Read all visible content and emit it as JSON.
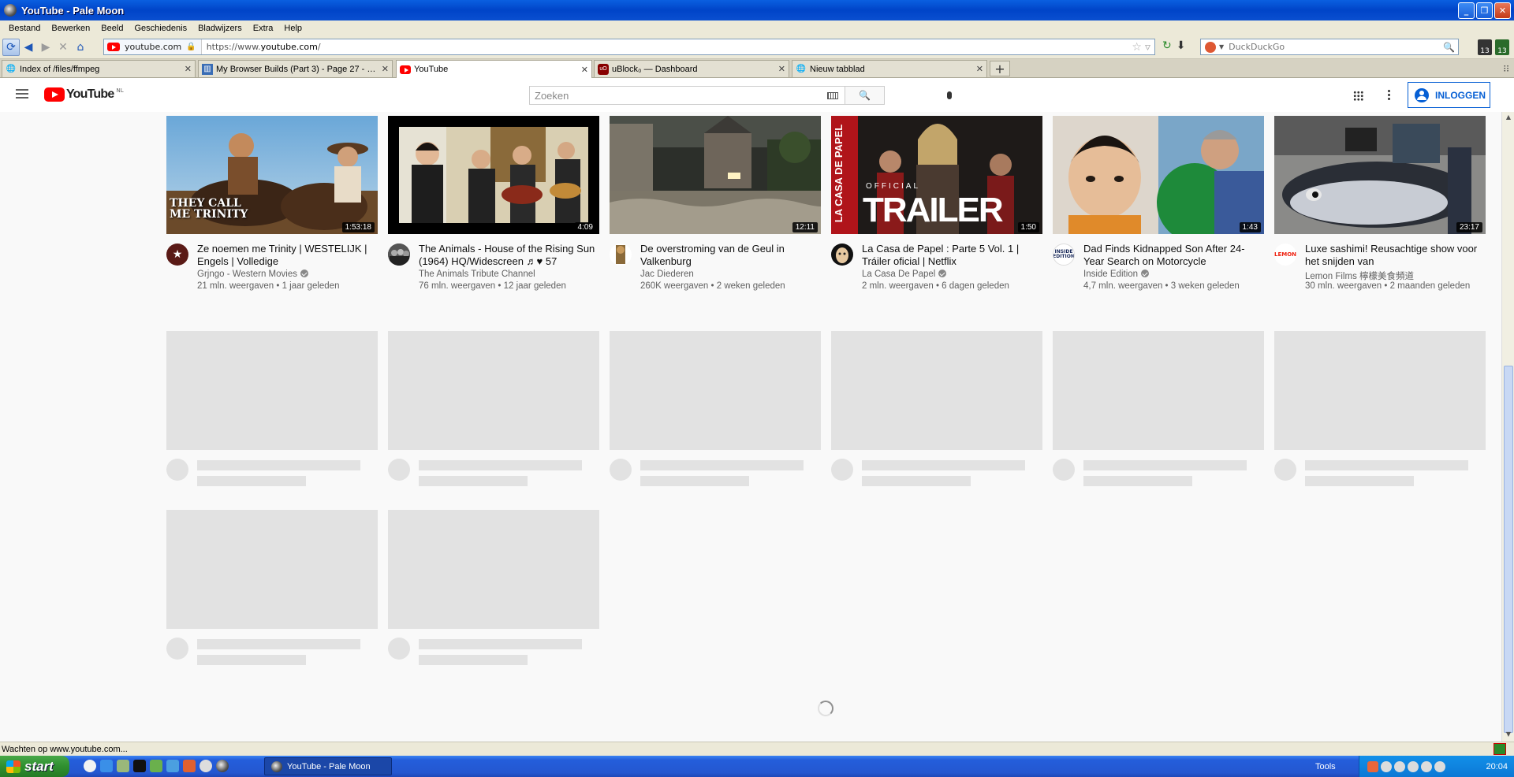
{
  "window": {
    "title": "YouTube - Pale Moon"
  },
  "menu": [
    "Bestand",
    "Bewerken",
    "Beeld",
    "Geschiedenis",
    "Bladwijzers",
    "Extra",
    "Help"
  ],
  "nav": {
    "identity": "youtube.com",
    "url_prefix": "https://www.",
    "url_host": "youtube.com",
    "url_suffix": "/",
    "search_placeholder": "DuckDuckGo",
    "ext_badge_1": "13",
    "ext_badge_2": "13"
  },
  "tabs": [
    {
      "label": "Index of /files/ffmpeg",
      "icon": "globe-icon"
    },
    {
      "label": "My Browser Builds (Part 3) - Page 27 - Wi...",
      "icon": "forum-icon"
    },
    {
      "label": "YouTube",
      "icon": "youtube-icon",
      "active": true
    },
    {
      "label": "uBlock₀ — Dashboard",
      "icon": "ublock-icon"
    },
    {
      "label": "Nieuw tabblad",
      "icon": "globe-icon"
    }
  ],
  "youtube": {
    "logo_text": "YouTube",
    "region": "NL",
    "search_placeholder": "Zoeken",
    "signin_label": "INLOGGEN"
  },
  "videos": [
    {
      "title": "Ze noemen me Trinity | WESTELIJK | Engels | Volledige",
      "channel": "Grjngo - Western Movies",
      "verified": true,
      "stats": "21 mln. weergaven • 1 jaar geleden",
      "duration": "1:53:18",
      "thumb_caption": "THEY CALL ME TRINITY",
      "avatar": "star"
    },
    {
      "title": "The Animals - House of the Rising Sun (1964) HQ/Widescreen ♬♥ 57",
      "channel": "The Animals Tribute Channel",
      "verified": false,
      "stats": "76 mln. weergaven • 12 jaar geleden",
      "duration": "4:09",
      "avatar": "band"
    },
    {
      "title": "De overstroming van de Geul in Valkenburg",
      "channel": "Jac Diederen",
      "verified": false,
      "stats": "260K weergaven • 2 weken geleden",
      "duration": "12:11",
      "avatar": "person"
    },
    {
      "title": "La Casa de Papel : Parte 5 Vol. 1 | Tráiler oficial | Netflix",
      "channel": "La Casa De Papel",
      "verified": true,
      "stats": "2 mln. weergaven • 6 dagen geleden",
      "duration": "1:50",
      "thumb_caption": "TRAILER",
      "thumb_side": "LA CASA DE PAPEL",
      "thumb_official": "OFFICIAL",
      "avatar": "mask"
    },
    {
      "title": "Dad Finds Kidnapped Son After 24-Year Search on Motorcycle",
      "channel": "Inside Edition",
      "verified": true,
      "stats": "4,7 mln. weergaven • 3 weken geleden",
      "duration": "1:43",
      "avatar_text": "INSIDE EDITION"
    },
    {
      "title": "Luxe sashimi! Reusachtige show voor het snijden van",
      "channel": "Lemon Films 檸檬美食頻道",
      "verified": false,
      "stats": "30 mln. weergaven • 2 maanden geleden",
      "duration": "23:17",
      "avatar_text": "LEMON"
    }
  ],
  "status": {
    "text": "Wachten op www.youtube.com..."
  },
  "taskbar": {
    "start_label": "start",
    "task_label": "YouTube - Pale Moon",
    "tools_label": "Tools",
    "clock": "20:04"
  }
}
